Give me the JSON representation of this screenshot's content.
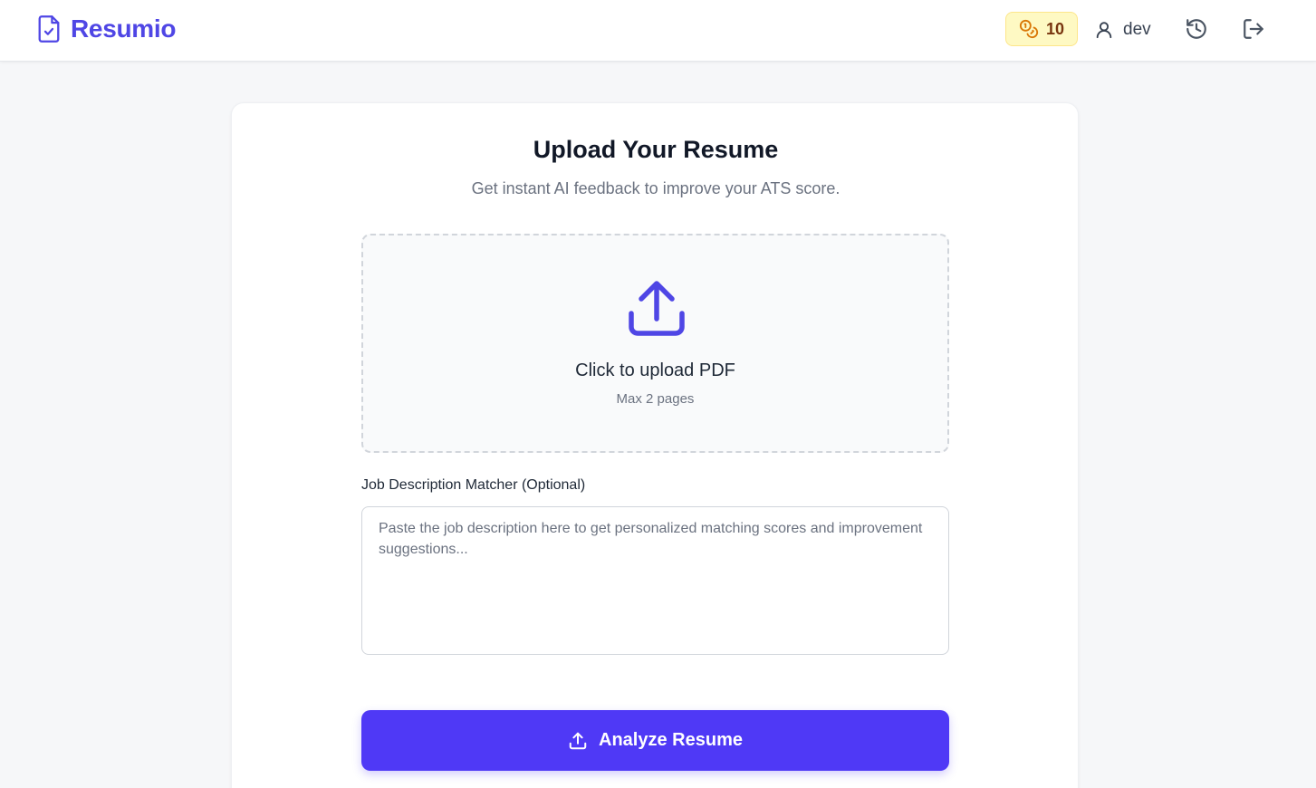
{
  "app": {
    "brand_name": "Resumio",
    "brand_icon": "file-check-icon",
    "accent_color": "#4f46e5"
  },
  "header": {
    "credits": {
      "icon": "coins-icon",
      "count": "10",
      "badge_color": "#fef9c3"
    },
    "user": {
      "icon": "user-icon",
      "name": "dev"
    },
    "history_icon": "history-icon",
    "logout_icon": "logout-icon"
  },
  "upload_card": {
    "title": "Upload Your Resume",
    "subtitle": "Get instant AI feedback to improve your ATS score.",
    "dropzone": {
      "icon": "upload-icon",
      "label": "Click to upload PDF",
      "hint": "Max 2 pages"
    },
    "job_description": {
      "label": "Job Description Matcher (Optional)",
      "placeholder": "Paste the job description here to get personalized matching scores and improvement suggestions...",
      "value": ""
    },
    "analyze_button": {
      "icon": "upload-icon",
      "label": "Analyze Resume",
      "color": "#4f39f6"
    }
  }
}
